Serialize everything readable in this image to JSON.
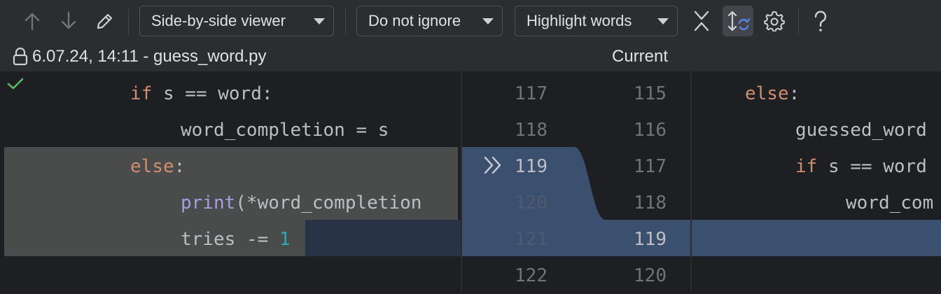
{
  "toolbar": {
    "viewer_label": "Side-by-side viewer",
    "ignore_label": "Do not ignore",
    "highlight_label": "Highlight words",
    "icons": [
      "arrow-up-icon",
      "arrow-down-icon",
      "edit-icon",
      "collapse-icon",
      "sync-scroll-icon",
      "gear-icon",
      "help-icon"
    ]
  },
  "header": {
    "left_title": "6.07.24, 14:11 - guess_word.py",
    "right_title": "Current"
  },
  "left_pane": {
    "lines": [
      {
        "kw": "if",
        "text": " s == word:"
      },
      {
        "text": "word_completion = s"
      },
      {
        "kw": "else",
        "text": ":"
      },
      {
        "fn": "print",
        "text": "(*word_completion"
      },
      {
        "text": "tries -= ",
        "num": "1"
      }
    ]
  },
  "middle_gutter": {
    "left_numbers": [
      "117",
      "118",
      "119",
      "120",
      "121",
      "122"
    ],
    "right_numbers": [
      "115",
      "116",
      "117",
      "118",
      "119",
      "120"
    ]
  },
  "right_pane": {
    "lines": [
      {
        "kw": "else",
        "text": ":"
      },
      {
        "text": "guessed_word"
      },
      {
        "kw": "if",
        "text": " s == word"
      },
      {
        "text": "word_com"
      }
    ]
  },
  "colors": {
    "background": "#1e1f22",
    "toolbar": "#2b2d30",
    "changed_block": "#4a4c4b",
    "inserted_block": "#3b506e",
    "word_diff": "#283346"
  }
}
